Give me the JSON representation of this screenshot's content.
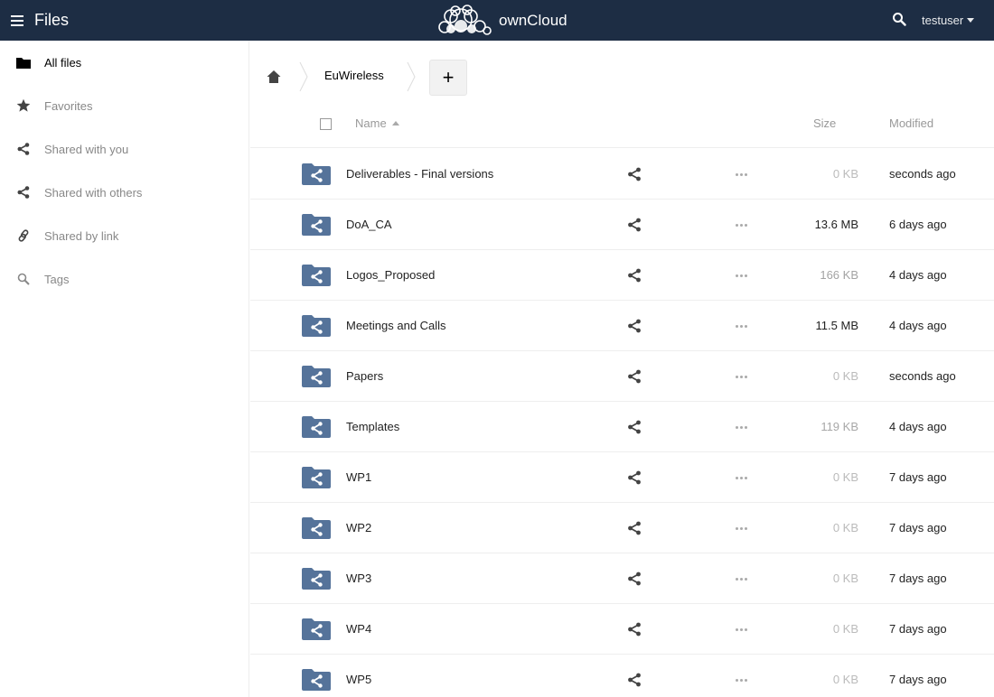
{
  "header": {
    "app_name": "Files",
    "logo_text": "ownCloud",
    "user": "testuser",
    "background_color": "#1d2d44"
  },
  "sidebar": {
    "items": [
      {
        "label": "All files",
        "icon": "folder-icon",
        "active": true
      },
      {
        "label": "Favorites",
        "icon": "star-icon",
        "active": false
      },
      {
        "label": "Shared with you",
        "icon": "share-icon",
        "active": false
      },
      {
        "label": "Shared with others",
        "icon": "share-icon",
        "active": false
      },
      {
        "label": "Shared by link",
        "icon": "link-icon",
        "active": false
      },
      {
        "label": "Tags",
        "icon": "tag-search-icon",
        "active": false
      }
    ]
  },
  "breadcrumb": {
    "home_icon": "home-icon",
    "current": "EuWireless",
    "add_label": "+"
  },
  "table": {
    "columns": {
      "name": "Name",
      "size": "Size",
      "modified": "Modified"
    },
    "rows": [
      {
        "name": "Deliverables - Final versions",
        "size": "0 KB",
        "modified": "seconds ago",
        "size_color": "#bbbbbb"
      },
      {
        "name": "DoA_CA",
        "size": "13.6 MB",
        "modified": "6 days ago",
        "size_color": "#222222"
      },
      {
        "name": "Logos_Proposed",
        "size": "166 KB",
        "modified": "4 days ago",
        "size_color": "#a3a3a3"
      },
      {
        "name": "Meetings and Calls",
        "size": "11.5 MB",
        "modified": "4 days ago",
        "size_color": "#222222"
      },
      {
        "name": "Papers",
        "size": "0 KB",
        "modified": "seconds ago",
        "size_color": "#bbbbbb"
      },
      {
        "name": "Templates",
        "size": "119 KB",
        "modified": "4 days ago",
        "size_color": "#a8a8a8"
      },
      {
        "name": "WP1",
        "size": "0 KB",
        "modified": "7 days ago",
        "size_color": "#bbbbbb"
      },
      {
        "name": "WP2",
        "size": "0 KB",
        "modified": "7 days ago",
        "size_color": "#bbbbbb"
      },
      {
        "name": "WP3",
        "size": "0 KB",
        "modified": "7 days ago",
        "size_color": "#bbbbbb"
      },
      {
        "name": "WP4",
        "size": "0 KB",
        "modified": "7 days ago",
        "size_color": "#bbbbbb"
      },
      {
        "name": "WP5",
        "size": "0 KB",
        "modified": "7 days ago",
        "size_color": "#bbbbbb"
      }
    ]
  }
}
